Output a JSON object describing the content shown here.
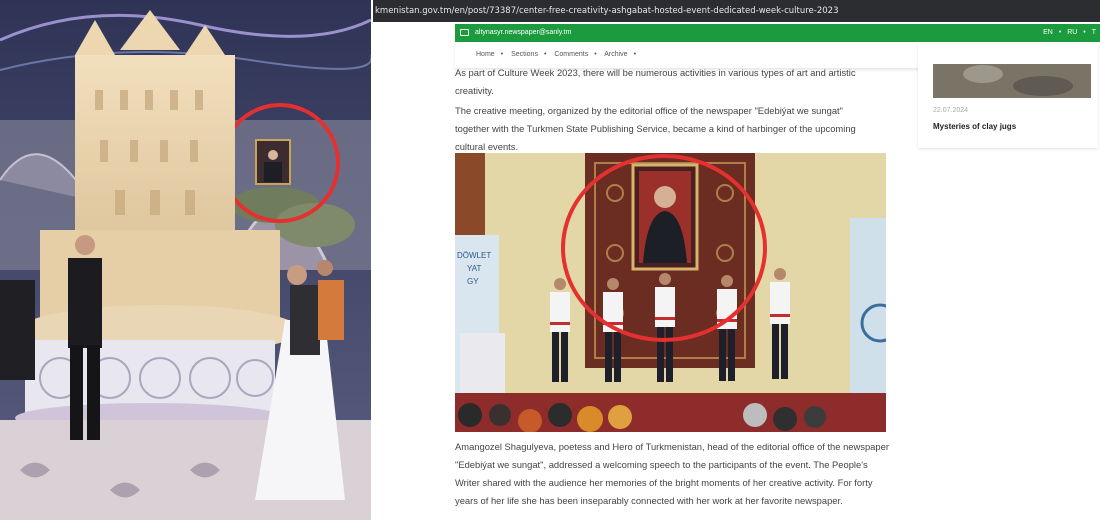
{
  "browser": {
    "url": "kmenistan.gov.tm/en/post/73387/center-free-creativity-ashgabat-hosted-event-dedicated-week-culture-2023"
  },
  "site": {
    "email": "altynasyr.newspaper@sanly.tm",
    "languages": [
      "EN",
      "RU",
      "T"
    ],
    "nav": [
      "Home",
      "Sections",
      "Comments",
      "Archive"
    ]
  },
  "article": {
    "para1": "As part of Culture Week 2023, there will be numerous activities in various types of art and artistic creativity.",
    "para2": "The creative meeting, organized by the editorial office of the newspaper \"Edebiýat we sungat\" together with the Turkmen State Publishing Service, became a kind of harbinger of the upcoming cultural events.",
    "para3": "Amangozel Shagulyeva, poetess and Hero of Turkmenistan, head of the editorial office of the newspaper \"Edebiýat we sungat\", addressed a welcoming speech to the participants of the event. The People's Writer shared with the audience her memories of the bright moments of her creative activity. For forty years of her life she has been inseparably connected with her work at her favorite newspaper.",
    "photo_banner_text": [
      "DÖWLET",
      "YAT",
      "GY"
    ]
  },
  "sidebar": {
    "date": "22.07.2024",
    "title": "Mysteries of clay jugs"
  },
  "colors": {
    "highlight_circle": "#e53030",
    "topbar_green": "#1c9a3e",
    "url_bar": "#2b2d31"
  }
}
